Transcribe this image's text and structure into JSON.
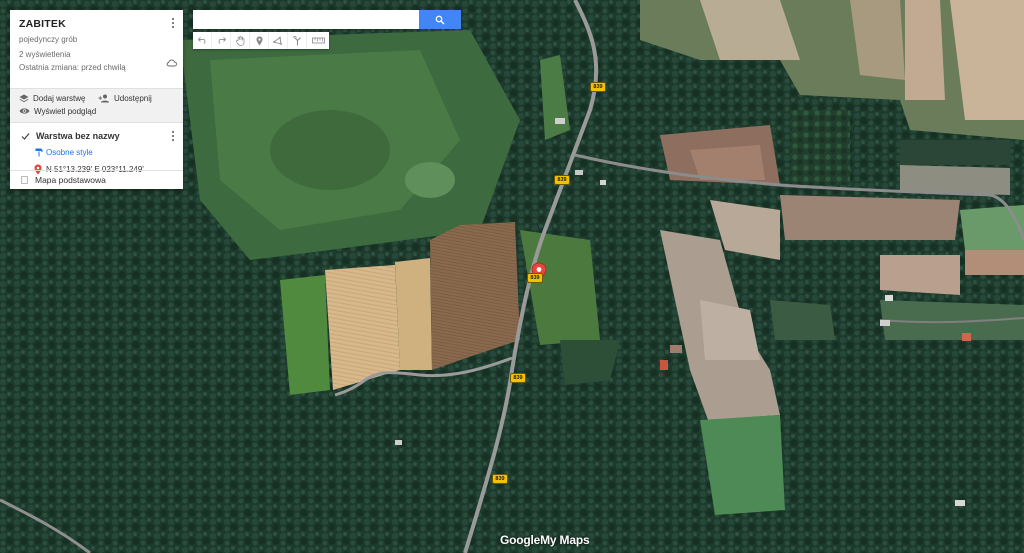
{
  "map": {
    "title": "ZABITEK",
    "description": "pojedynczy grób",
    "views": "2 wyświetlenia",
    "last_modified": "Ostatnia zmiana: przed chwilą",
    "actions": {
      "add_layer": "Dodaj warstwę",
      "share": "Udostępnij",
      "preview": "Wyświetl podgląd"
    },
    "layer": {
      "name": "Warstwa bez nazwy",
      "style_link": "Osobne style",
      "placemark": "N 51°13.239' E 023°11.249'"
    },
    "base_map": "Mapa podstawowa"
  },
  "search": {
    "placeholder": "",
    "value": ""
  },
  "toolbar": {
    "icons": [
      "undo-icon",
      "redo-icon",
      "hand-icon",
      "marker-icon",
      "line-icon",
      "route-icon",
      "ruler-icon"
    ]
  },
  "road_label": "839",
  "logo": {
    "google": "Google",
    "mymaps": "My Maps"
  },
  "colors": {
    "search_button": "#4285f4",
    "marker": "#e8453c",
    "link": "#1a73e8",
    "shield": "#f2c200"
  }
}
